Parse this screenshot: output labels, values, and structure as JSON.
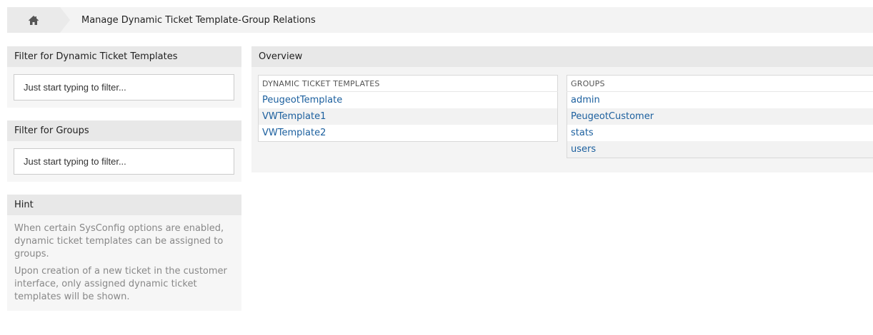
{
  "breadcrumb": {
    "home_icon": "home-icon",
    "title": "Manage Dynamic Ticket Template-Group Relations"
  },
  "sidebar": {
    "filter_templates": {
      "title": "Filter for Dynamic Ticket Templates",
      "placeholder": "Just start typing to filter..."
    },
    "filter_groups": {
      "title": "Filter for Groups",
      "placeholder": "Just start typing to filter..."
    },
    "hint": {
      "title": "Hint",
      "paragraphs": [
        "When certain SysConfig options are enabled, dynamic ticket templates can be assigned to groups.",
        "Upon creation of a new ticket in the customer interface, only assigned dynamic ticket templates will be shown."
      ]
    }
  },
  "overview": {
    "title": "Overview",
    "templates": {
      "header": "DYNAMIC TICKET TEMPLATES",
      "items": [
        "PeugeotTemplate",
        "VWTemplate1",
        "VWTemplate2"
      ]
    },
    "groups": {
      "header": "GROUPS",
      "items": [
        "admin",
        "PeugeotCustomer",
        "stats",
        "users"
      ]
    }
  },
  "colors": {
    "link": "#1b5f9e",
    "header_bg": "#e8e8e8",
    "panel_bg": "#f6f6f6"
  }
}
